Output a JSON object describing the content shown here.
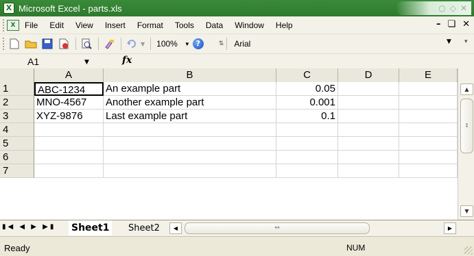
{
  "window": {
    "title": "Microsoft Excel - parts.xls",
    "app_icon": "excel-icon"
  },
  "menu": {
    "items": [
      "File",
      "Edit",
      "View",
      "Insert",
      "Format",
      "Tools",
      "Data",
      "Window",
      "Help"
    ],
    "right_controls": [
      "_",
      "æ",
      "×"
    ]
  },
  "toolbar": {
    "zoom": "100%",
    "font": "Arial"
  },
  "formula_bar": {
    "name_box": "A1",
    "fx_label": "fx"
  },
  "grid": {
    "columns": [
      "A",
      "B",
      "C",
      "D",
      "E"
    ],
    "rows": [
      {
        "num": "1",
        "A": "ABC-1234",
        "B": "An example part",
        "C": "0.05",
        "D": "",
        "E": ""
      },
      {
        "num": "2",
        "A": "MNO-4567",
        "B": "Another example part",
        "C": "0.001",
        "D": "",
        "E": ""
      },
      {
        "num": "3",
        "A": "XYZ-9876",
        "B": "Last example part",
        "C": "0.1",
        "D": "",
        "E": ""
      },
      {
        "num": "4",
        "A": "",
        "B": "",
        "C": "",
        "D": "",
        "E": ""
      },
      {
        "num": "5",
        "A": "",
        "B": "",
        "C": "",
        "D": "",
        "E": ""
      },
      {
        "num": "6",
        "A": "",
        "B": "",
        "C": "",
        "D": "",
        "E": ""
      },
      {
        "num": "7",
        "A": "",
        "B": "",
        "C": "",
        "D": "",
        "E": ""
      }
    ]
  },
  "sheets": {
    "active": "Sheet1",
    "others": [
      "Sheet2"
    ]
  },
  "status": {
    "text": "Ready",
    "indicator": "NUM"
  },
  "colors": {
    "title_bar": "#2e7a2e",
    "chrome": "#f3f1e8",
    "header": "#eae8dc"
  }
}
